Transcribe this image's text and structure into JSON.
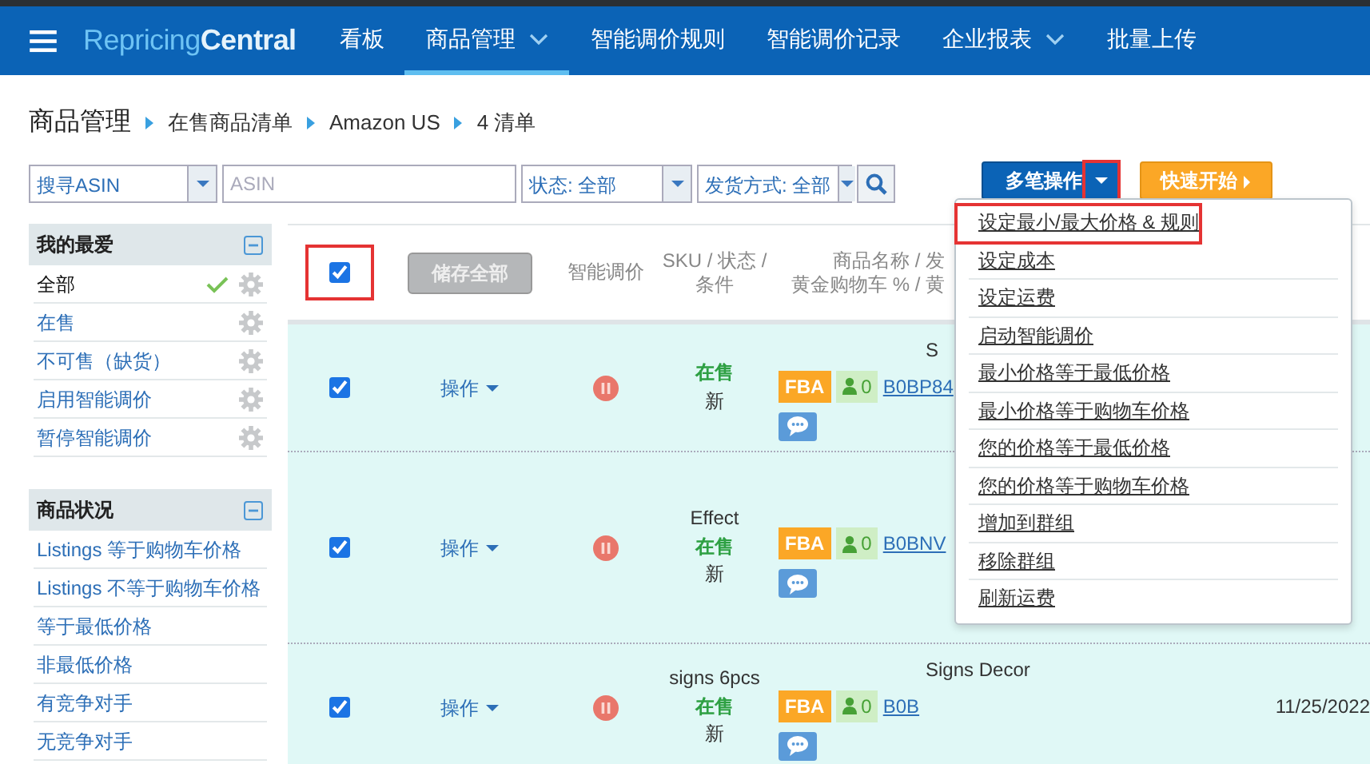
{
  "navbar": {
    "brand_parts": [
      "Repricing",
      "Central"
    ],
    "items": [
      {
        "label": "看板",
        "selected": false,
        "has_caret": false
      },
      {
        "label": "商品管理",
        "selected": true,
        "has_caret": true
      },
      {
        "label": "智能调价规则",
        "selected": false,
        "has_caret": false
      },
      {
        "label": "智能调价记录",
        "selected": false,
        "has_caret": false
      },
      {
        "label": "企业报表",
        "selected": false,
        "has_caret": true
      },
      {
        "label": "批量上传",
        "selected": false,
        "has_caret": false
      }
    ]
  },
  "breadcrumb": [
    "商品管理",
    "在售商品清单",
    "Amazon US",
    "4 清单"
  ],
  "filters": [
    {
      "kind": "select",
      "value": "搜寻ASIN"
    },
    {
      "kind": "input",
      "placeholder": "ASIN"
    },
    {
      "kind": "select",
      "value": "状态: 全部"
    },
    {
      "kind": "select",
      "value": "发货方式: 全部"
    }
  ],
  "bulk_button": {
    "label": "多笔操作",
    "highlighted": true
  },
  "quick_button": {
    "label": "快速开始"
  },
  "bulk_menu": [
    {
      "label": "设定最小/最大价格 & 规则",
      "highlighted": true
    },
    {
      "label": "设定成本",
      "highlighted": false
    },
    {
      "label": "设定运费",
      "highlighted": false
    },
    {
      "label": "启动智能调价",
      "highlighted": false
    },
    {
      "label": "最小价格等于最低价格",
      "highlighted": false
    },
    {
      "label": "最小价格等于购物车价格",
      "highlighted": false
    },
    {
      "label": "您的价格等于最低价格",
      "highlighted": false
    },
    {
      "label": "您的价格等于购物车价格",
      "highlighted": false
    },
    {
      "label": "增加到群组",
      "highlighted": false
    },
    {
      "label": "移除群组",
      "highlighted": false
    },
    {
      "label": "刷新运费",
      "highlighted": false
    }
  ],
  "sidebar": [
    {
      "title": "我的最爱",
      "expanded": true,
      "items": [
        {
          "label": "全部",
          "selected": true,
          "has_gear": true
        },
        {
          "label": "在售",
          "selected": false,
          "has_gear": true
        },
        {
          "label": "不可售（缺货）",
          "selected": false,
          "has_gear": true
        },
        {
          "label": "启用智能调价",
          "selected": false,
          "has_gear": true
        },
        {
          "label": "暂停智能调价",
          "selected": false,
          "has_gear": true
        }
      ]
    },
    {
      "title": "商品状况",
      "expanded": true,
      "items": [
        {
          "label": "Listings 等于购物车价格",
          "selected": false,
          "has_gear": false
        },
        {
          "label": "Listings 不等于购物车价格",
          "selected": false,
          "has_gear": false
        },
        {
          "label": "等于最低价格",
          "selected": false,
          "has_gear": false
        },
        {
          "label": "非最低价格",
          "selected": false,
          "has_gear": false
        },
        {
          "label": "有竞争对手",
          "selected": false,
          "has_gear": false
        },
        {
          "label": "无竞争对手",
          "selected": false,
          "has_gear": false
        }
      ]
    }
  ],
  "table": {
    "select_all": {
      "checked": true,
      "highlighted": true
    },
    "save_all": {
      "label": "储存全部",
      "disabled": true
    },
    "columns": [
      "智能调价",
      "SKU / 状态 / 条件",
      [
        "商品名称 / 发",
        "黄金购物车 % / 黄"
      ]
    ],
    "rows": [
      {
        "checked": true,
        "action": "操作",
        "sku_lines": [],
        "status": "在售",
        "condition": "新",
        "fulfillment": "FBA",
        "offers": "0",
        "asin": "B0BP84",
        "product_name": "S",
        "date": ""
      },
      {
        "checked": true,
        "action": "操作",
        "sku_lines": [
          "Effect"
        ],
        "status": "在售",
        "condition": "新",
        "fulfillment": "FBA",
        "offers": "0",
        "asin": "B0BNV",
        "product_name": "",
        "date": ""
      },
      {
        "checked": true,
        "action": "操作",
        "sku_lines": [
          "signs 6pcs"
        ],
        "status": "在售",
        "condition": "新",
        "fulfillment": "FBA",
        "offers": "0",
        "asin": "B0B",
        "product_name": "Signs Decor",
        "date": "11/25/2022"
      }
    ]
  }
}
